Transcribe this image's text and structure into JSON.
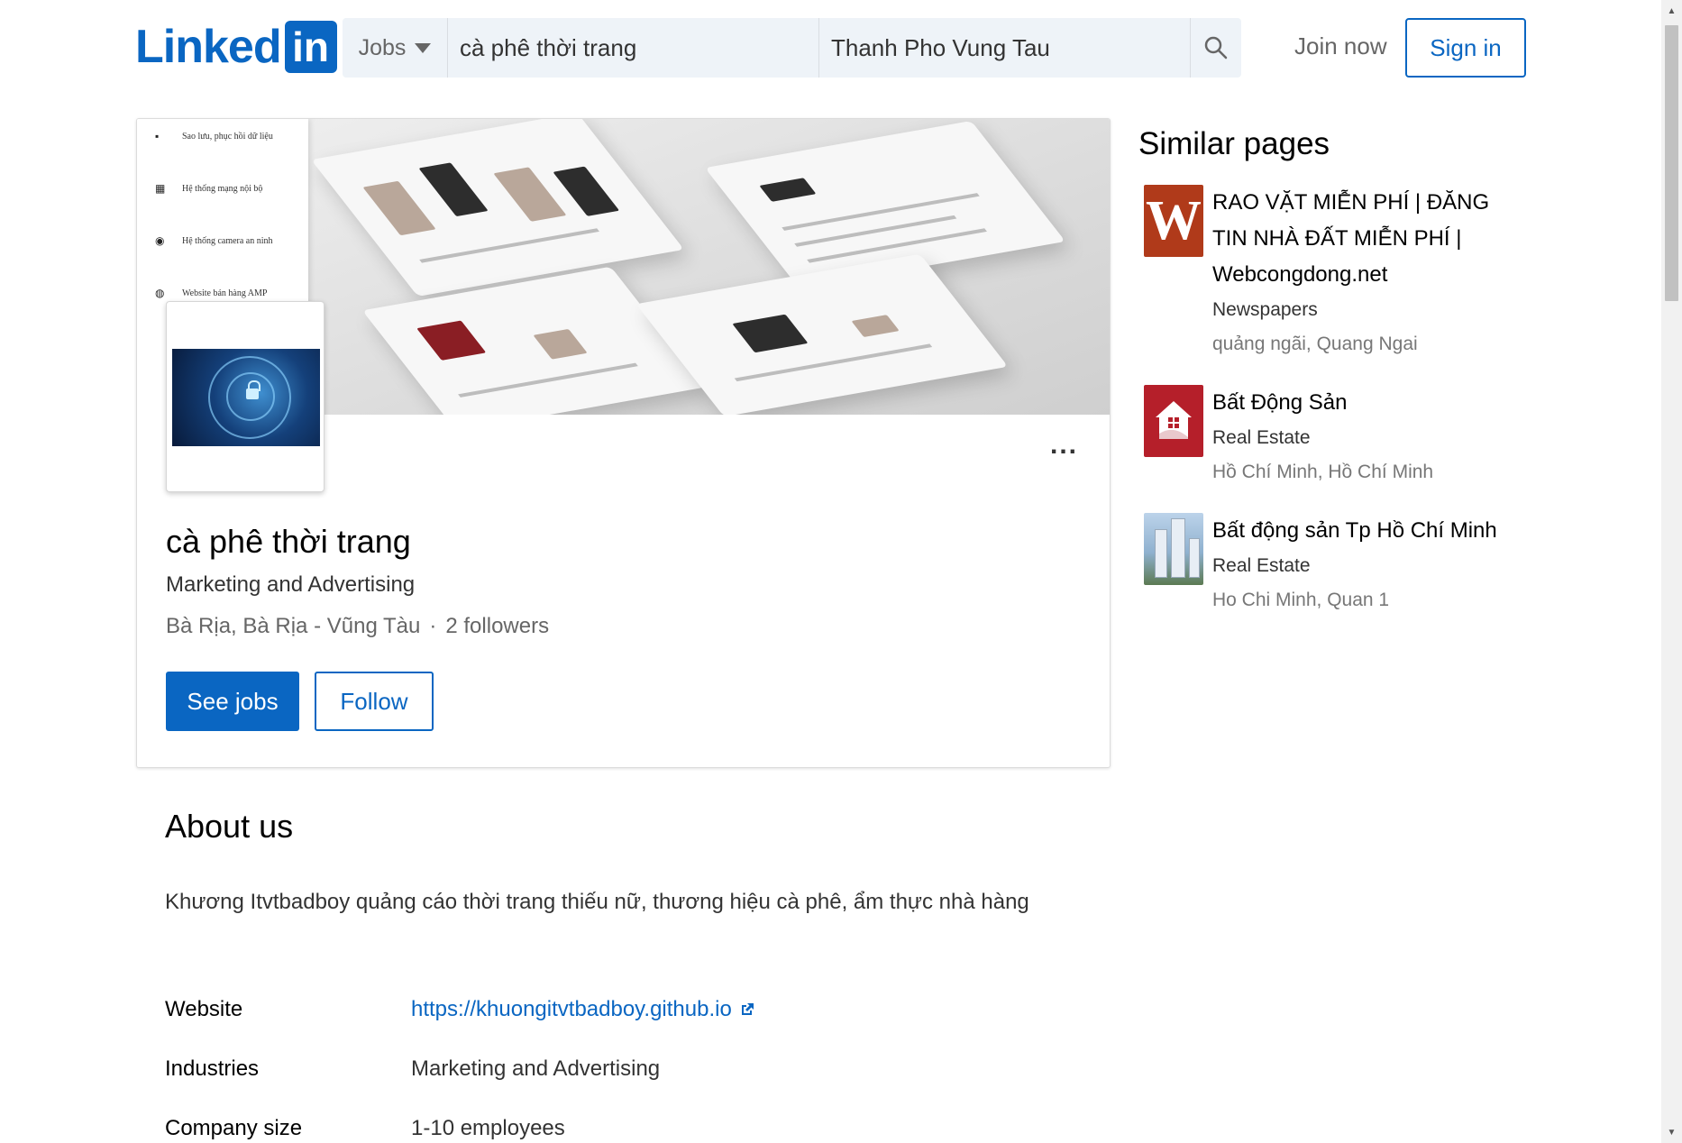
{
  "header": {
    "logo_text": "Linked",
    "logo_box": "in",
    "search": {
      "type_label": "Jobs",
      "keywords_value": "cà phê thời trang",
      "location_value": "Thanh Pho Vung Tau"
    },
    "join_label": "Join now",
    "signin_label": "Sign in"
  },
  "cover": {
    "menu_items": [
      {
        "icon": "▪",
        "label": "Sao lưu, phục hồi dữ liệu"
      },
      {
        "icon": "▦",
        "label": "Hệ thống mạng nội bộ"
      },
      {
        "icon": "◉",
        "label": "Hệ thống camera an ninh"
      },
      {
        "icon": "◍",
        "label": "Website bán hàng AMP"
      }
    ]
  },
  "organization": {
    "name": "cà phê thời trang",
    "industry": "Marketing and Advertising",
    "location": "Bà Rịa, Bà Rịa - Vũng Tàu",
    "separator": "·",
    "followers": "2 followers",
    "more_label": "...",
    "see_jobs_label": "See jobs",
    "follow_label": "Follow"
  },
  "about": {
    "title": "About us",
    "description": "Khương Itvtbadboy quảng cáo thời trang thiếu nữ, thương hiệu cà phê, ẩm thực nhà hàng",
    "details": [
      {
        "label": "Website",
        "value": "https://khuongitvtbadboy.github.io",
        "is_link": true
      },
      {
        "label": "Industries",
        "value": "Marketing and Advertising",
        "is_link": false
      },
      {
        "label": "Company size",
        "value": "1-10 employees",
        "is_link": false
      }
    ]
  },
  "similar_pages": {
    "title": "Similar pages",
    "items": [
      {
        "name": "RAO VẶT MIỄN PHÍ | ĐĂNG TIN NHÀ ĐẤT MIỄN PHÍ | Webcongdong.net",
        "industry": "Newspapers",
        "location": "quảng ngãi, Quang Ngai",
        "logo": "W"
      },
      {
        "name": "Bất Động Sản",
        "industry": "Real Estate",
        "location": "Hồ Chí Minh, Hồ Chí Minh",
        "logo": "house-icon"
      },
      {
        "name": "Bất động sản Tp Hồ Chí Minh",
        "industry": "Real Estate",
        "location": "Ho Chi Minh, Quan 1",
        "logo": "building-photo"
      }
    ]
  },
  "colors": {
    "brand": "#0a66c2",
    "search_bg": "#eef3f8",
    "muted_text": "#666666"
  }
}
